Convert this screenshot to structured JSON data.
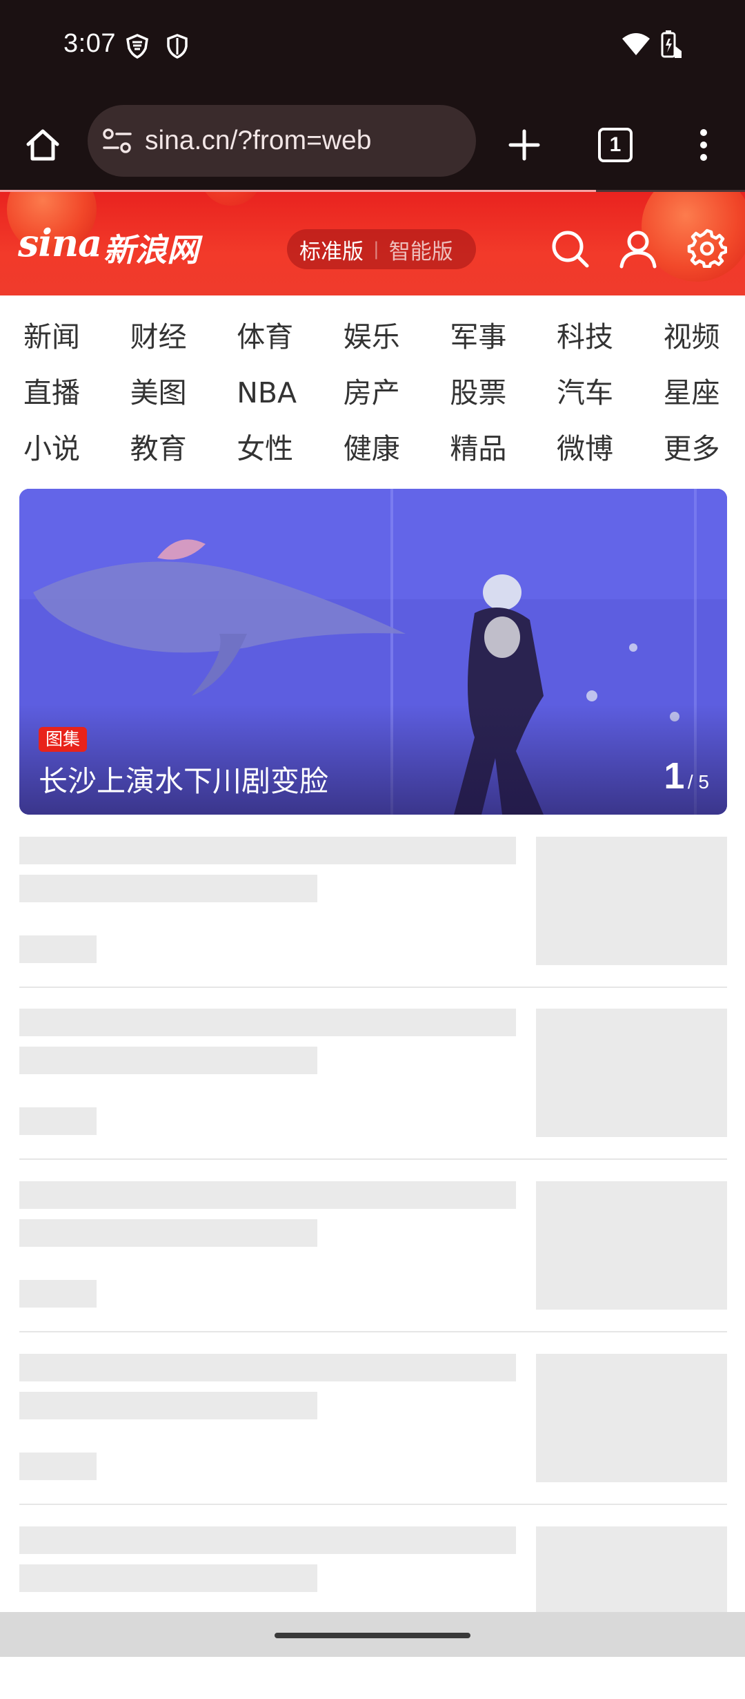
{
  "status_bar": {
    "time": "3:07"
  },
  "browser": {
    "url": "sina.cn/?from=web",
    "tab_count": "1",
    "load_progress": 0.8
  },
  "sina_header": {
    "logo_en": "sina",
    "logo_cn": "新浪网",
    "version_standard": "标准版",
    "version_smart": "智能版"
  },
  "nav": {
    "items": [
      "新闻",
      "财经",
      "体育",
      "娱乐",
      "军事",
      "科技",
      "视频",
      "直播",
      "美图",
      "NBA",
      "房产",
      "股票",
      "汽车",
      "星座",
      "小说",
      "教育",
      "女性",
      "健康",
      "精品",
      "微博",
      "更多"
    ]
  },
  "hero": {
    "tag": "图集",
    "title": "长沙上演水下川剧变脸",
    "current": "1",
    "total": "/ 5"
  },
  "colors": {
    "status_bg": "#1b1112",
    "brand_red": "#e9231f",
    "skeleton": "#eaeaea"
  }
}
